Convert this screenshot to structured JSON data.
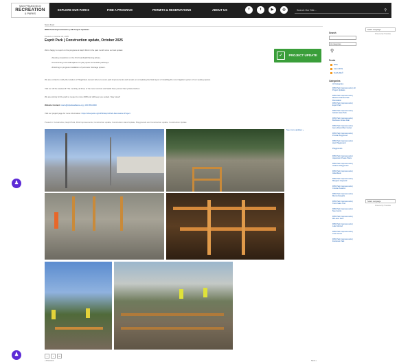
{
  "header": {
    "logo": {
      "line1": "SAN FRANCISCO",
      "line2": "RECREATION",
      "line3": "& PARKS"
    },
    "nav": [
      "EXPLORE OUR PARKS",
      "FIND A PROGRAM",
      "PERMITS & RESERVATIONS",
      "ABOUT US"
    ],
    "social": [
      "f",
      "t",
      "▶",
      "◎"
    ],
    "search_placeholder": "Search Our Site..."
  },
  "breadcrumb": "News Feed",
  "section_link": "RPD Park Improvements | All Project Updates",
  "post": {
    "date": "Posted on October 22, 2025",
    "title": "Esprit Park | Construction update, October 2025",
    "intro": "We're happy to report on the progress at Esprit Park in the past month since our last update:",
    "bullets": [
      "Nearing completion on the first boardwalk/framing phase.",
      "Constructing rock wall adjacent to play space accessible pathways.",
      "Finishing in-progress installation of perimeter drainage system."
    ],
    "para2": "We are excited to notify the location of Tlingit/dear cement where to cover park improvements and remain on completing the final layout of installing the new irrigation system of our seating spaces.",
    "para3": "Visit our off the weekend! This monthly, all three of the new concrete wall walls have poured their private kitchen.",
    "para4": "We are aiming for the park to reopen to more 2025 and will keep you posted. Stay tuned!",
    "contact_label": "Website Contact:",
    "contact_value": "mario@sfparksalliance.org, 415-555-0000",
    "project_label": "Visit our project page for more information:",
    "project_link": "https://sfrecpark.org/1451/Esprit-Park-Renovation-Project",
    "tags": "Posted in: Construction, Esprit Park, Park Improvements, Construction update, Construction stand Update, Playgrounds and Construction update, Construction Update",
    "more_link": "See more updates »"
  },
  "badge": {
    "label": "PROJECT UPDATE",
    "icon": "clipboard-icon"
  },
  "share": [
    "f",
    "t",
    "✉"
  ],
  "pagination": {
    "prev": "« Previous",
    "next": "Next »"
  },
  "sidebar": {
    "search_title": "Search",
    "category_select": "All categories",
    "feeds_title": "Feeds",
    "feeds": [
      "RSS",
      "Atom RSS",
      "Notify Me®"
    ],
    "categories_title": "Categories",
    "categories": [
      "All Categories",
      "RPD Park Improvements | All Project Updates",
      "RPD Park Improvements | Mission Dolores Park Renovation",
      "RPD Park Improvements | Esprit Park",
      "RPD Park Improvements | Golden Gate Park",
      "RPD Park Improvements | Buchanan Street Mall",
      "RPD Park Improvements | Gene Friend Rec Center",
      "RPD Park Improvements | Portola Playground",
      "RPD Park Improvements | Herz Playground",
      "Playgrounds",
      "RPD Park Improvements | Japantown Peace Plaza",
      "RPD Park Improvements | Jackson Playground",
      "RPD Park Improvements | India Basin",
      "RPD Park Improvements | Margaret Hayward",
      "RPD Park Improvements | Crocker Amazon",
      "RPD Park Improvements | Merced Heights",
      "RPD Park Improvements | Twin Peaks Trail",
      "RPD Park Improvements | Noe Courts",
      "RPD Park Improvements | McLaren Park",
      "RPD Park Improvements | Lake Merced",
      "RPD Park Improvements | Civic Center",
      "RPD Park Improvements | Francisco Park"
    ]
  },
  "language": {
    "label": "Select Language",
    "sub": "Powered by Translate"
  },
  "accessibility": {
    "label": "Accessibility",
    "icon": "accessibility-icon",
    "color": "#5d2bd6"
  },
  "colors": {
    "header": "#1f1f1f",
    "badge": "#3a9e3a",
    "link": "#1a5fb4"
  }
}
